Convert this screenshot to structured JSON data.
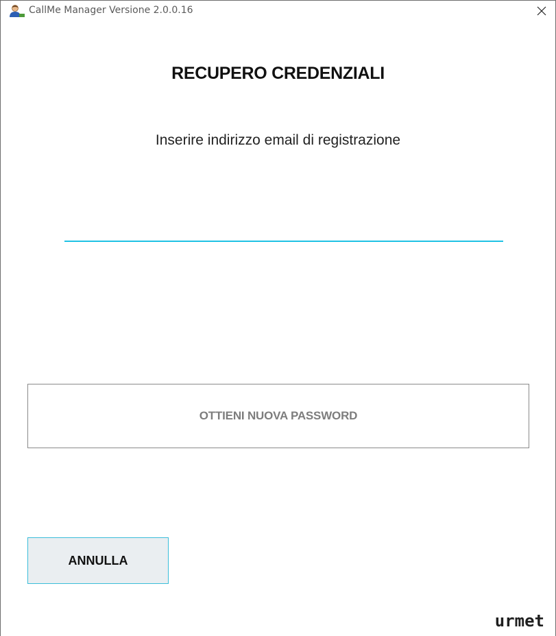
{
  "window": {
    "title": "CallMe Manager Versione 2.0.0.16",
    "app_icon": "user-icon",
    "close_icon": "close-icon"
  },
  "dialog": {
    "heading": "RECUPERO CREDENZIALI",
    "instruction": "Inserire indirizzo email di registrazione",
    "email_value": "",
    "email_placeholder": "",
    "submit_label": "OTTIENI NUOVA PASSWORD",
    "cancel_label": "ANNULLA"
  },
  "brand": {
    "logo_text": "urmet"
  },
  "colors": {
    "accent": "#1ec1e4",
    "cancel_border": "#39bdd9",
    "disabled_text": "#7d7d7d"
  }
}
